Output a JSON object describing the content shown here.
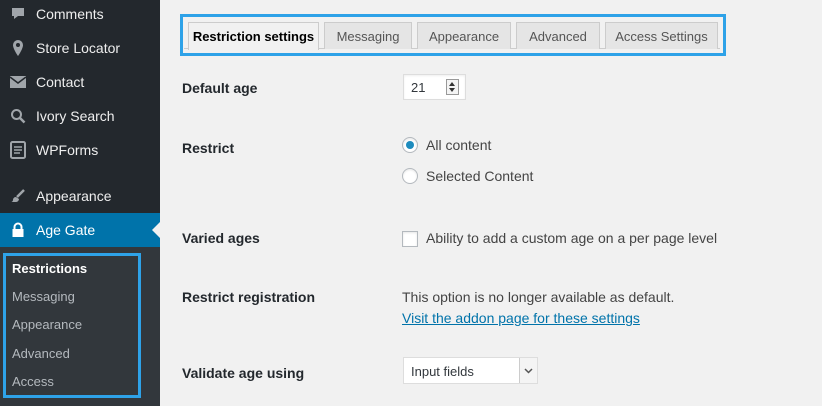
{
  "sidebar": {
    "items": [
      {
        "label": "Comments",
        "icon": "comment-icon"
      },
      {
        "label": "Store Locator",
        "icon": "map-pin-icon"
      },
      {
        "label": "Contact",
        "icon": "envelope-icon"
      },
      {
        "label": "Ivory Search",
        "icon": "search-icon"
      },
      {
        "label": "WPForms",
        "icon": "forms-icon"
      },
      {
        "label": "Appearance",
        "icon": "brush-icon"
      },
      {
        "label": "Age Gate",
        "icon": "lock-icon"
      }
    ],
    "submenu": [
      "Restrictions",
      "Messaging",
      "Appearance",
      "Advanced",
      "Access"
    ]
  },
  "tabs": [
    "Restriction settings",
    "Messaging",
    "Appearance",
    "Advanced",
    "Access Settings"
  ],
  "form": {
    "default_age": {
      "label": "Default age",
      "value": "21"
    },
    "restrict": {
      "label": "Restrict",
      "options": [
        "All content",
        "Selected Content"
      ],
      "selected": "All content"
    },
    "varied_ages": {
      "label": "Varied ages",
      "checkbox_label": "Ability to add a custom age on a per page level",
      "checked": false
    },
    "restrict_registration": {
      "label": "Restrict registration",
      "note": "This option is no longer available as default.",
      "link": "Visit the addon page for these settings"
    },
    "validate_age": {
      "label": "Validate age using",
      "value": "Input fields"
    }
  },
  "colors": {
    "sidebar_bg": "#23282d",
    "current_item_bg": "#0073aa",
    "highlight": "#2ea2e8",
    "link": "#0073aa"
  }
}
